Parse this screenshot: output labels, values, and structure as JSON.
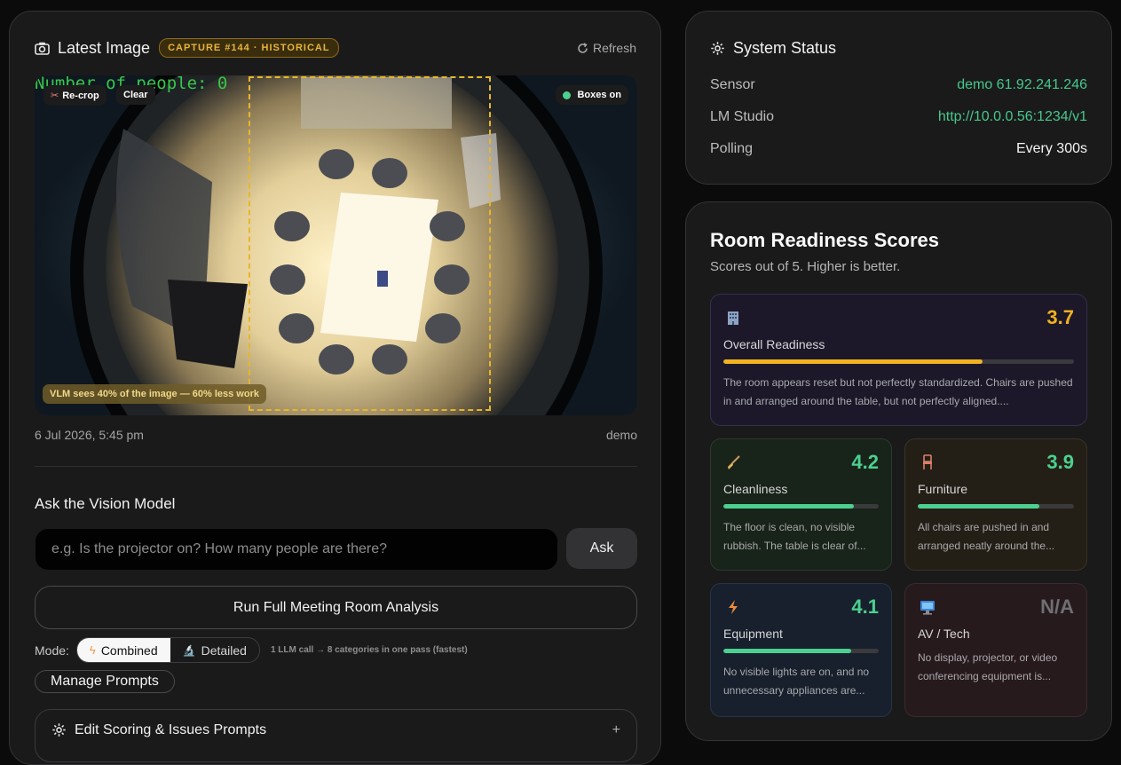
{
  "latest": {
    "title": "Latest Image",
    "badge": "CAPTURE #144 · HISTORICAL",
    "refresh_label": "Refresh",
    "overlay_text": "Number of people: 0",
    "recrop_label": "Re-crop",
    "clear_label": "Clear",
    "boxes_label": "Boxes on",
    "vlm_note": "VLM sees 40% of the image — 60% less work",
    "timestamp": "6 Jul 2026, 5:45 pm",
    "source": "demo",
    "crop_fraction": 0.4
  },
  "ask": {
    "title": "Ask the Vision Model",
    "placeholder": "e.g. Is the projector on? How many people are there?",
    "button": "Ask",
    "run_button": "Run Full Meeting Room Analysis",
    "mode_label": "Mode:",
    "mode_combined": "Combined",
    "mode_detailed": "Detailed",
    "mode_note": "1 LLM call → 8 categories in one pass (fastest)",
    "manage_prompts": "Manage Prompts",
    "edit_prompts": "Edit Scoring & Issues Prompts",
    "edit_toggle": "+"
  },
  "status": {
    "title": "System Status",
    "rows": [
      {
        "key": "Sensor",
        "value": "demo 61.92.241.246"
      },
      {
        "key": "LM Studio",
        "value": "http://10.0.0.56:1234/v1"
      },
      {
        "key": "Polling",
        "value": "Every 300s"
      }
    ]
  },
  "scores": {
    "title": "Room Readiness Scores",
    "subtitle": "Scores out of 5. Higher is better.",
    "overall": {
      "icon": "building-icon",
      "label": "Overall Readiness",
      "score": "3.7",
      "value": 3.7,
      "color": "#f0b21f",
      "desc": "The room appears reset but not perfectly standardized. Chairs are pushed in and arranged around the table, but not perfectly aligned...."
    },
    "items": [
      {
        "icon": "broom-icon",
        "label": "Cleanliness",
        "score": "4.2",
        "value": 4.2,
        "color": "#4cd08f",
        "desc": "The floor is clean, no visible rubbish. The table is clear of..."
      },
      {
        "icon": "chair-icon",
        "label": "Furniture",
        "score": "3.9",
        "value": 3.9,
        "color": "#4cd08f",
        "desc": "All chairs are pushed in and arranged neatly around the..."
      },
      {
        "icon": "lightning-icon",
        "label": "Equipment",
        "score": "4.1",
        "value": 4.1,
        "color": "#4cd08f",
        "desc": "No visible lights are on, and no unnecessary appliances are..."
      },
      {
        "icon": "monitor-icon",
        "label": "AV / Tech",
        "score": "N/A",
        "value": null,
        "color": "#6f6f72",
        "desc": "No display, projector, or video conferencing equipment is..."
      }
    ]
  }
}
